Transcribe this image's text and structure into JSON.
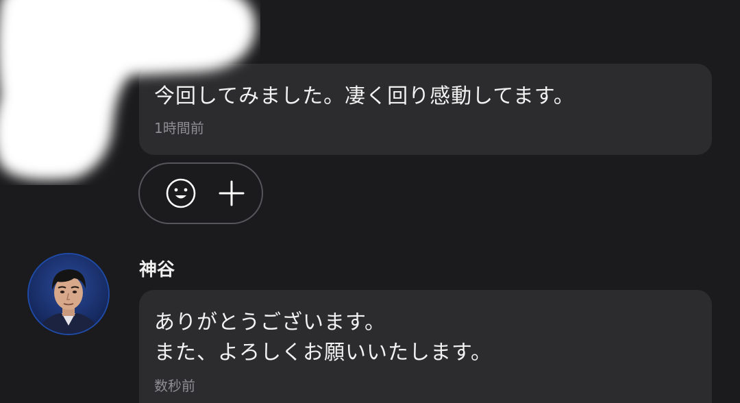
{
  "conversation": {
    "first_message": {
      "text": "今回してみました。凄く回り感動してます。",
      "time": "1時間前"
    },
    "reactions": {
      "emoji_icon": "smile-face-icon",
      "add_icon": "plus-icon"
    },
    "reply": {
      "sender_name": "神谷",
      "avatar_icon": "profile-photo",
      "text": "ありがとうございます。\nまた、よろしくお願いいたします。",
      "time": "数秒前"
    }
  },
  "colors": {
    "background": "#1b1b1d",
    "bubble": "#2c2c2e",
    "timestamp": "#8e8e93",
    "pill_border": "#55555a",
    "avatar_ring": "#1f4aa5"
  }
}
